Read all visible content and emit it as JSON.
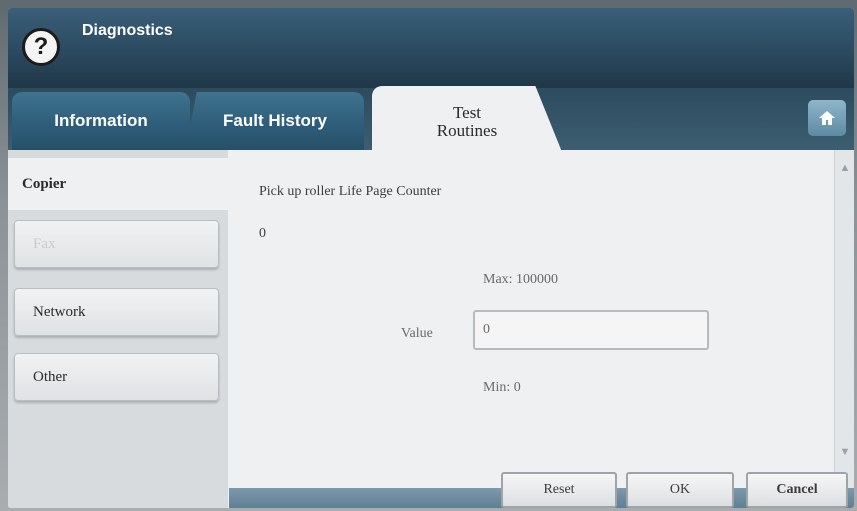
{
  "window": {
    "title": "Diagnostics",
    "help_icon_glyph": "?"
  },
  "tabs": [
    {
      "label": "Information",
      "active": false
    },
    {
      "label": "Fault History",
      "active": false
    },
    {
      "label_line1": "Test",
      "label_line2": "Routines",
      "active": true
    }
  ],
  "home_icon": "home-icon",
  "sidebar": {
    "items": [
      {
        "label": "Copier",
        "selected": true
      },
      {
        "label": "Fax",
        "disabled": true
      },
      {
        "label": "Network"
      },
      {
        "label": "Other"
      }
    ]
  },
  "main": {
    "counter_label": "Pick up roller Life Page Counter",
    "counter_value": "0",
    "max_label": "Max: 100000",
    "value_label": "Value",
    "value_input": "0",
    "min_label": "Min: 0"
  },
  "actions": {
    "reset_label": "Reset",
    "ok_label": "OK",
    "cancel_label": "Cancel"
  },
  "colors": {
    "title_bar": "#2b4a60",
    "tab_inactive": "#2e5c78",
    "tab_active": "#eef0f2",
    "content_bg": "#eef0f1"
  }
}
